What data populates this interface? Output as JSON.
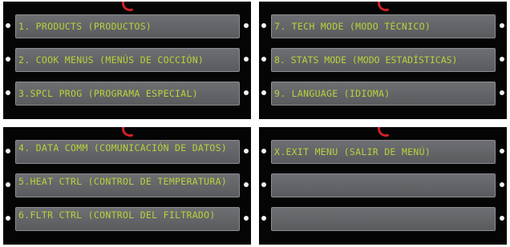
{
  "panels": [
    {
      "items": [
        {
          "label": "1. PRODUCTS (PRODUCTOS)"
        },
        {
          "label": "2. COOK MENUS (MENÚS DE COCCIÓN)"
        },
        {
          "label": "3.SPCL PROG (PROGRAMA ESPECIAL)"
        }
      ]
    },
    {
      "items": [
        {
          "label": "7. TECH MODE (MODO TÉCNICO)"
        },
        {
          "label": "8. STATS MODE (MODO ESTADÍSTICAS)"
        },
        {
          "label": "9. LANGUAGE (IDIOMA)"
        }
      ]
    },
    {
      "items": [
        {
          "label": "4. DATA COMM (COMUNICACIÓN DE DATOS)"
        },
        {
          "label": "5.HEAT CTRL (CONTROL DE TEMPERATURA)"
        },
        {
          "label": "6.FLTR CTRL (CONTROL DEL FILTRADO)"
        }
      ]
    },
    {
      "items": [
        {
          "label": "x.EXIT MENU (SALIR DE MENÚ)"
        },
        {
          "label": ""
        },
        {
          "label": ""
        }
      ]
    }
  ],
  "colors": {
    "screen_bg": "#050505",
    "button_bg": "#636568",
    "button_text": "#b7d23a",
    "logo_red": "#d2202a",
    "indicator_dot": "#f2f2f2"
  },
  "icons": {
    "logo": "brand-swoosh-icon",
    "side_buttons": "indicator-dot-icon"
  }
}
